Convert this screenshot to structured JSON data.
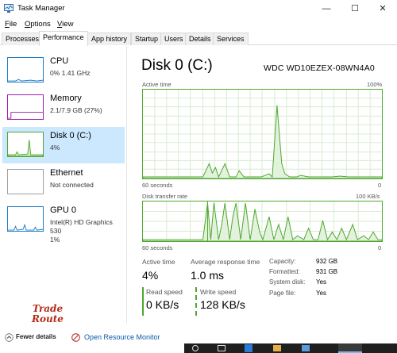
{
  "window": {
    "title": "Task Manager"
  },
  "menu": {
    "items": [
      {
        "u": "F",
        "rest": "ile"
      },
      {
        "u": "O",
        "rest": "ptions"
      },
      {
        "u": "V",
        "rest": "iew"
      }
    ]
  },
  "tabs": [
    "Processes",
    "Performance",
    "App history",
    "Startup",
    "Users",
    "Details",
    "Services"
  ],
  "active_tab": "Performance",
  "sidebar": {
    "items": [
      {
        "name": "CPU",
        "sub": "0% 1.41 GHz",
        "color": "#1e7ec8"
      },
      {
        "name": "Memory",
        "sub": "2.1/7.9 GB (27%)",
        "color": "#9e1fae"
      },
      {
        "name": "Disk 0 (C:)",
        "sub": "4%",
        "color": "#4ea72e"
      },
      {
        "name": "Ethernet",
        "sub": "Not connected",
        "color": "#a0a0a0"
      },
      {
        "name": "GPU 0",
        "sub": "Intel(R) HD Graphics 530",
        "sub2": "1%",
        "color": "#1e7ec8"
      }
    ]
  },
  "main": {
    "title": "Disk 0 (C:)",
    "model": "WDC WD10EZEX-08WN4A0",
    "graph1": {
      "label": "Active time",
      "max": "100%",
      "xlabel": "60 seconds",
      "min": "0"
    },
    "graph2": {
      "label": "Disk transfer rate",
      "max": "100 KB/s",
      "xlabel": "60 seconds",
      "min": "0"
    },
    "stats": {
      "active_time_label": "Active time",
      "active_time_value": "4%",
      "avg_response_label": "Average response time",
      "avg_response_value": "1.0 ms",
      "read_speed_label": "Read speed",
      "read_speed_value": "0 KB/s",
      "write_speed_label": "Write speed",
      "write_speed_value": "128 KB/s"
    },
    "properties": [
      {
        "key": "Capacity:",
        "value": "932 GB"
      },
      {
        "key": "Formatted:",
        "value": "931 GB"
      },
      {
        "key": "System disk:",
        "value": "Yes"
      },
      {
        "key": "Page file:",
        "value": "Yes"
      }
    ]
  },
  "footer": {
    "fewer_details": "Fewer details",
    "open_monitor": "Open Resource Monitor"
  },
  "watermark": {
    "line1": "Trade",
    "line2": "Route"
  },
  "colors": {
    "disk_green": "#4ea72e",
    "selected_bg": "#cce8ff",
    "link": "#0b5aa8"
  }
}
